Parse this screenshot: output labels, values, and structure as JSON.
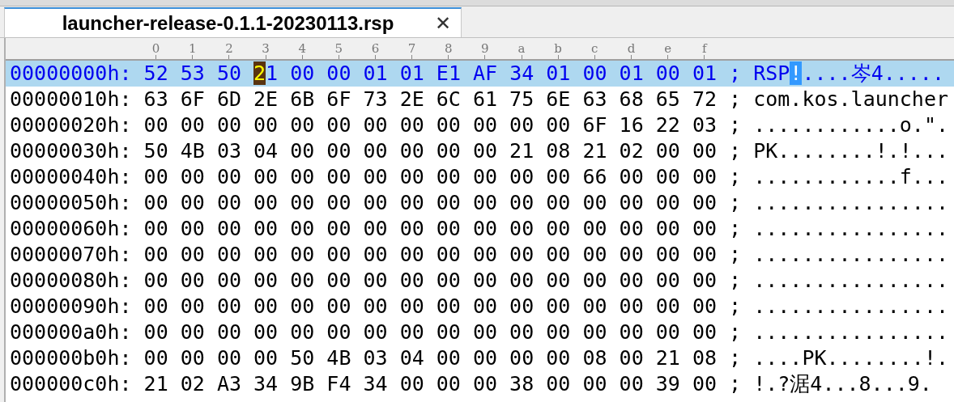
{
  "tab": {
    "title": "launcher-release-0.1.1-20230113.rsp",
    "close": "✕",
    "selected": true
  },
  "ruler": [
    "0",
    "1",
    "2",
    "3",
    "4",
    "5",
    "6",
    "7",
    "8",
    "9",
    "a",
    "b",
    "c",
    "d",
    "e",
    "f"
  ],
  "rows": [
    {
      "offset": "00000000h:",
      "selected": true,
      "hex": [
        {
          "kind": "plain",
          "text": "52 53 50 "
        },
        {
          "kind": "cursor",
          "text": "2"
        },
        {
          "kind": "plain",
          "text": "1 00 00 01 01 E1 AF 34 01 00 01 00 01"
        }
      ],
      "ascii": [
        {
          "kind": "plain",
          "text": "RSP"
        },
        {
          "kind": "cursor",
          "text": "!"
        },
        {
          "kind": "plain",
          "text": "....岑4....."
        }
      ]
    },
    {
      "offset": "00000010h:",
      "selected": false,
      "hex": [
        {
          "kind": "plain",
          "text": "63 6F 6D 2E 6B 6F 73 2E 6C 61 75 6E 63 68 65 72"
        }
      ],
      "ascii": [
        {
          "kind": "plain",
          "text": "com.kos.launcher"
        }
      ]
    },
    {
      "offset": "00000020h:",
      "selected": false,
      "hex": [
        {
          "kind": "plain",
          "text": "00 00 00 00 00 00 00 00 00 00 00 00 6F 16 22 03"
        }
      ],
      "ascii": [
        {
          "kind": "plain",
          "text": "............o.\"."
        }
      ]
    },
    {
      "offset": "00000030h:",
      "selected": false,
      "hex": [
        {
          "kind": "plain",
          "text": "50 4B 03 04 00 00 00 00 00 00 21 08 21 02 00 00"
        }
      ],
      "ascii": [
        {
          "kind": "plain",
          "text": "PK........!.!..."
        }
      ]
    },
    {
      "offset": "00000040h:",
      "selected": false,
      "hex": [
        {
          "kind": "plain",
          "text": "00 00 00 00 00 00 00 00 00 00 00 00 66 00 00 00"
        }
      ],
      "ascii": [
        {
          "kind": "plain",
          "text": "............f..."
        }
      ]
    },
    {
      "offset": "00000050h:",
      "selected": false,
      "hex": [
        {
          "kind": "plain",
          "text": "00 00 00 00 00 00 00 00 00 00 00 00 00 00 00 00"
        }
      ],
      "ascii": [
        {
          "kind": "plain",
          "text": "................"
        }
      ]
    },
    {
      "offset": "00000060h:",
      "selected": false,
      "hex": [
        {
          "kind": "plain",
          "text": "00 00 00 00 00 00 00 00 00 00 00 00 00 00 00 00"
        }
      ],
      "ascii": [
        {
          "kind": "plain",
          "text": "................"
        }
      ]
    },
    {
      "offset": "00000070h:",
      "selected": false,
      "hex": [
        {
          "kind": "plain",
          "text": "00 00 00 00 00 00 00 00 00 00 00 00 00 00 00 00"
        }
      ],
      "ascii": [
        {
          "kind": "plain",
          "text": "................"
        }
      ]
    },
    {
      "offset": "00000080h:",
      "selected": false,
      "hex": [
        {
          "kind": "plain",
          "text": "00 00 00 00 00 00 00 00 00 00 00 00 00 00 00 00"
        }
      ],
      "ascii": [
        {
          "kind": "plain",
          "text": "................"
        }
      ]
    },
    {
      "offset": "00000090h:",
      "selected": false,
      "hex": [
        {
          "kind": "plain",
          "text": "00 00 00 00 00 00 00 00 00 00 00 00 00 00 00 00"
        }
      ],
      "ascii": [
        {
          "kind": "plain",
          "text": "................"
        }
      ]
    },
    {
      "offset": "000000a0h:",
      "selected": false,
      "hex": [
        {
          "kind": "plain",
          "text": "00 00 00 00 00 00 00 00 00 00 00 00 00 00 00 00"
        }
      ],
      "ascii": [
        {
          "kind": "plain",
          "text": "................"
        }
      ]
    },
    {
      "offset": "000000b0h:",
      "selected": false,
      "hex": [
        {
          "kind": "plain",
          "text": "00 00 00 00 50 4B 03 04 00 00 00 00 08 00 21 08"
        }
      ],
      "ascii": [
        {
          "kind": "plain",
          "text": "....PK........!."
        }
      ]
    },
    {
      "offset": "000000c0h:",
      "selected": false,
      "hex": [
        {
          "kind": "plain",
          "text": "21 02 A3 34 9B F4 34 00 00 00 38 00 00 00 39 00"
        }
      ],
      "ascii": [
        {
          "kind": "plain",
          "text": "!.?涺4...8...9."
        }
      ]
    }
  ],
  "separator": ";"
}
